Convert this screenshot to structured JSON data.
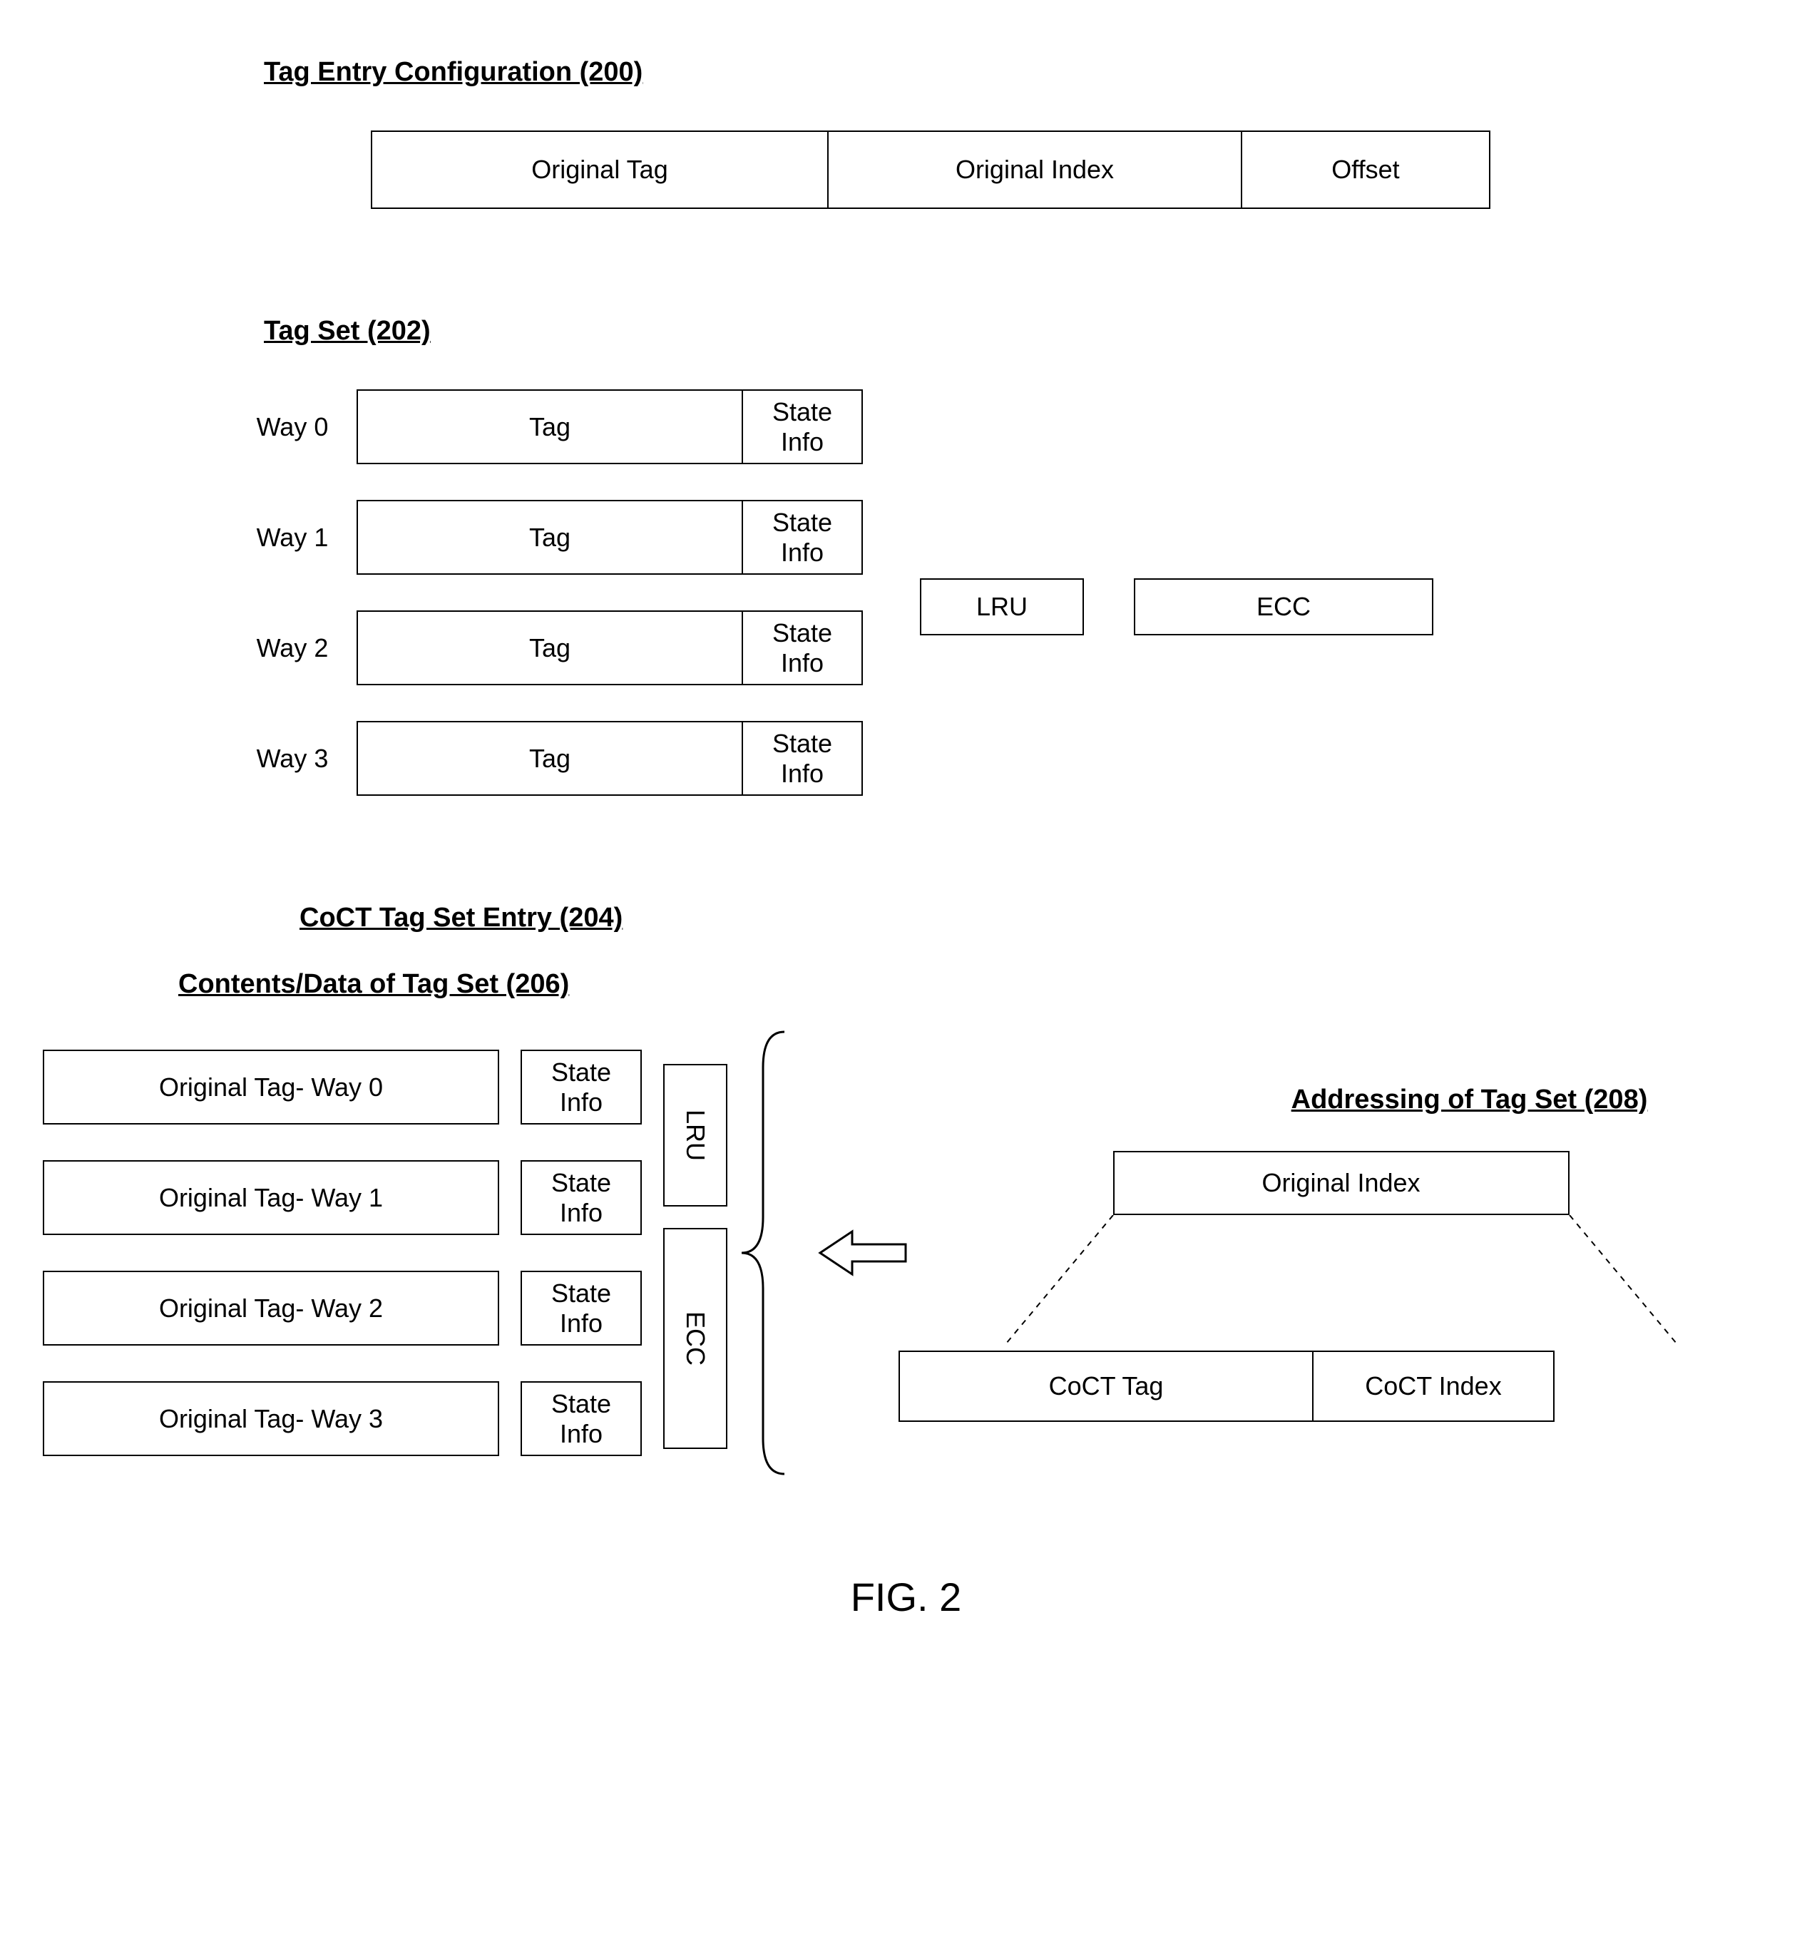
{
  "section_200": {
    "title": "Tag Entry Configuration (200)",
    "cells": [
      "Original Tag",
      "Original Index",
      "Offset"
    ]
  },
  "section_202": {
    "title": "Tag Set (202)",
    "ways": [
      {
        "label": "Way 0",
        "tag": "Tag",
        "state": "State Info"
      },
      {
        "label": "Way 1",
        "tag": "Tag",
        "state": "State Info"
      },
      {
        "label": "Way 2",
        "tag": "Tag",
        "state": "State Info"
      },
      {
        "label": "Way 3",
        "tag": "Tag",
        "state": "State Info"
      }
    ],
    "lru": "LRU",
    "ecc": "ECC"
  },
  "section_204": {
    "title": "CoCT Tag Set Entry (204)",
    "contents_title": "Contents/Data of Tag Set (206)",
    "ways": [
      {
        "tag": "Original Tag- Way 0",
        "state": "State Info"
      },
      {
        "tag": "Original Tag- Way 1",
        "state": "State Info"
      },
      {
        "tag": "Original Tag- Way 2",
        "state": "State Info"
      },
      {
        "tag": "Original Tag- Way 3",
        "state": "State Info"
      }
    ],
    "lru": "LRU",
    "ecc": "ECC",
    "addressing_title": "Addressing of Tag Set (208)",
    "original_index": "Original Index",
    "coct_tag": "CoCT Tag",
    "coct_index": "CoCT Index"
  },
  "figure_caption": "FIG. 2"
}
